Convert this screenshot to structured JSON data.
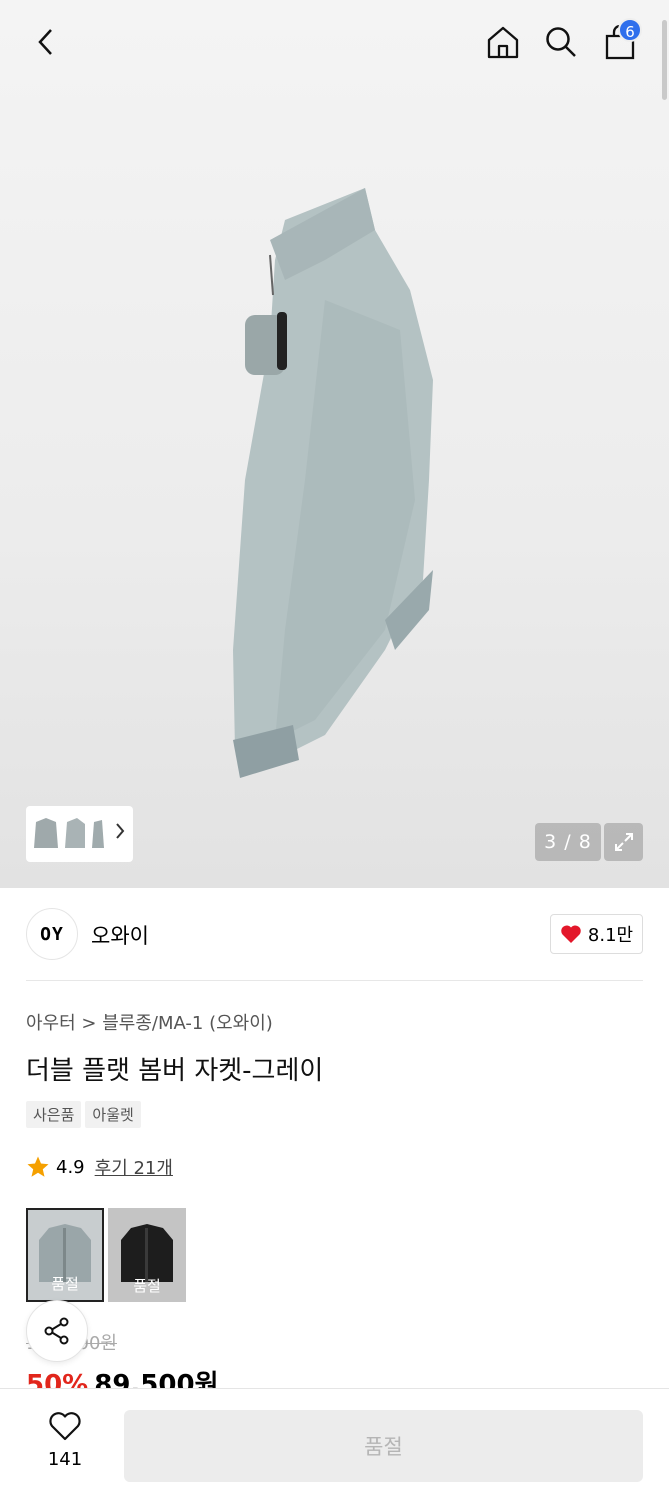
{
  "topbar": {
    "cart_count": "6"
  },
  "gallery": {
    "counter": "3 / 8"
  },
  "brand": {
    "logo_text": "OY",
    "name": "오와이",
    "likes": "8.1만"
  },
  "product": {
    "category": "아우터 > 블루종/MA-1 (오와이)",
    "title": "더블 플랫 봄버 자켓-그레이",
    "tags": [
      "사은품",
      "아울렛"
    ],
    "rating": "4.9",
    "review_link": "후기 21개",
    "swatches": [
      {
        "label": "품절",
        "color": "gray"
      },
      {
        "label": "품절",
        "color": "black"
      }
    ],
    "original_price": "179,000원",
    "discount": "50%",
    "price": "89,500원"
  },
  "bottom": {
    "wish_count": "141",
    "buy_label": "품절"
  },
  "colors": {
    "discount": "#e1261c",
    "badge": "#2f6fec",
    "heart": "#e3172a"
  }
}
